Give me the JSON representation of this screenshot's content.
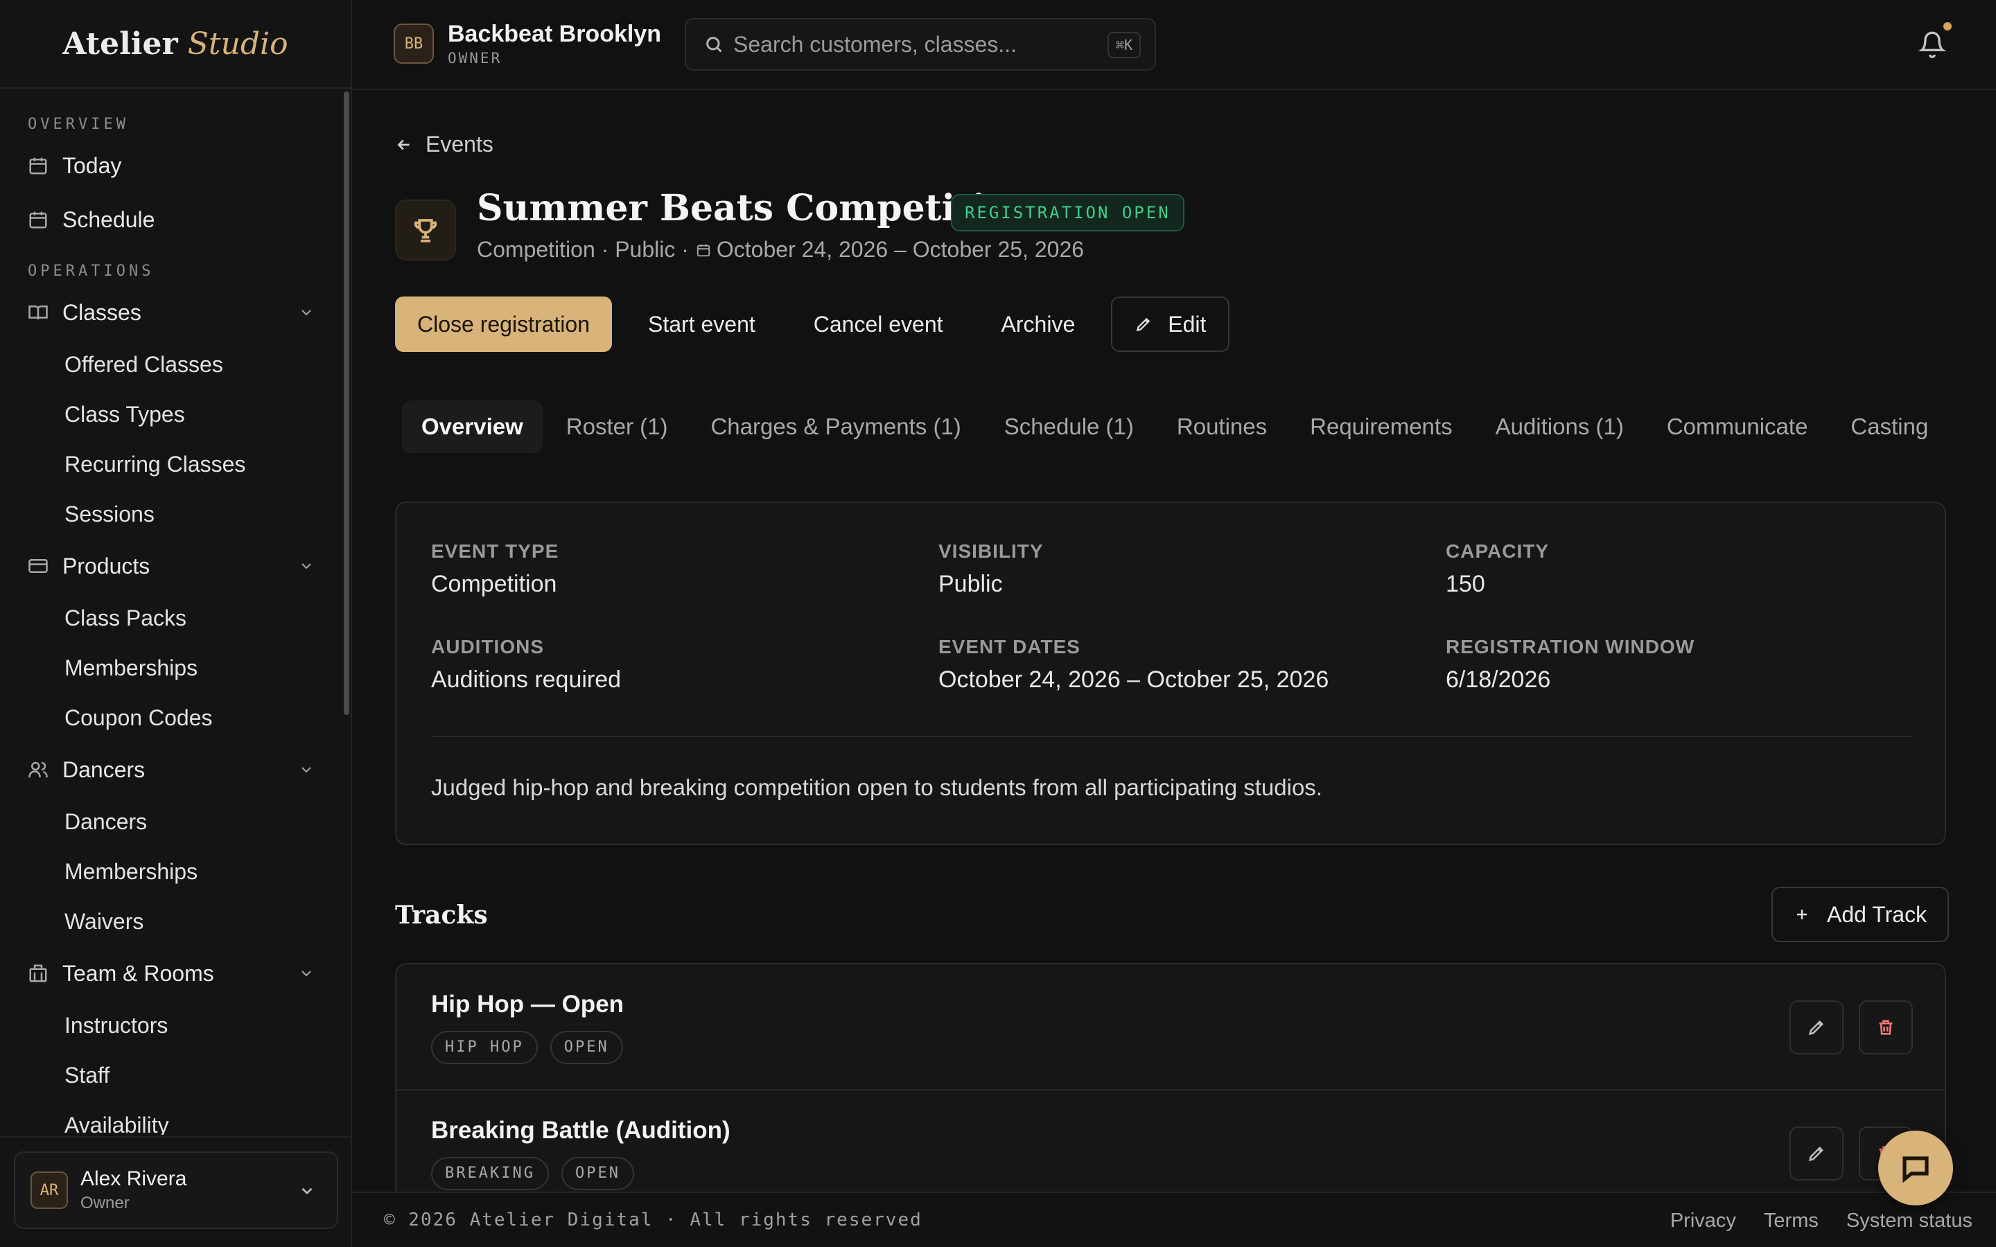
{
  "brand": {
    "name": "Atelier",
    "accent": "Studio",
    "accent_color": "#d8b37a"
  },
  "org": {
    "initials": "BB",
    "name": "Backbeat Brooklyn",
    "role": "OWNER"
  },
  "search": {
    "placeholder": "Search customers, classes...",
    "shortcut": "⌘K"
  },
  "sidebar": {
    "overview_title": "OVERVIEW",
    "today": "Today",
    "schedule": "Schedule",
    "operations_title": "OPERATIONS",
    "classes": "Classes",
    "classes_items": [
      "Offered Classes",
      "Class Types",
      "Recurring Classes",
      "Sessions"
    ],
    "products": "Products",
    "products_items": [
      "Class Packs",
      "Memberships",
      "Coupon Codes"
    ],
    "dancers": "Dancers",
    "dancers_items": [
      "Dancers",
      "Memberships",
      "Waivers"
    ],
    "team": "Team & Rooms",
    "team_items": [
      "Instructors",
      "Staff",
      "Availability"
    ]
  },
  "user": {
    "initials": "AR",
    "name": "Alex Rivera",
    "role": "Owner"
  },
  "breadcrumb": {
    "back_label": "Events"
  },
  "event": {
    "title": "Summer Beats Competition",
    "status": "REGISTRATION OPEN",
    "status_color": "#3dcf8a",
    "meta": "Competition · Public ·",
    "dates": "October 24, 2026 – October 25, 2026"
  },
  "actions": {
    "close_registration": "Close registration",
    "start_event": "Start event",
    "cancel_event": "Cancel event",
    "archive": "Archive",
    "edit": "Edit"
  },
  "tabs": [
    "Overview",
    "Roster (1)",
    "Charges & Payments (1)",
    "Schedule (1)",
    "Routines",
    "Requirements",
    "Auditions (1)",
    "Communicate",
    "Casting"
  ],
  "active_tab": "Overview",
  "details": {
    "event_type_label": "EVENT TYPE",
    "event_type": "Competition",
    "visibility_label": "VISIBILITY",
    "visibility": "Public",
    "capacity_label": "CAPACITY",
    "capacity": "150",
    "auditions_label": "AUDITIONS",
    "auditions": "Auditions required",
    "event_dates_label": "EVENT DATES",
    "event_dates": "October 24, 2026 – October 25, 2026",
    "registration_window_label": "REGISTRATION WINDOW",
    "registration_window": "6/18/2026",
    "description": "Judged hip-hop and breaking competition open to students from all participating studios."
  },
  "tracks": {
    "title": "Tracks",
    "add_label": "Add Track",
    "items": [
      {
        "name": "Hip Hop — Open",
        "chips": [
          "HIP HOP",
          "OPEN"
        ]
      },
      {
        "name": "Breaking Battle (Audition)",
        "chips": [
          "BREAKING",
          "OPEN"
        ]
      }
    ]
  },
  "footer": {
    "copyright": "© 2026 Atelier Digital · All rights reserved",
    "links": [
      "Privacy",
      "Terms",
      "System status"
    ]
  }
}
